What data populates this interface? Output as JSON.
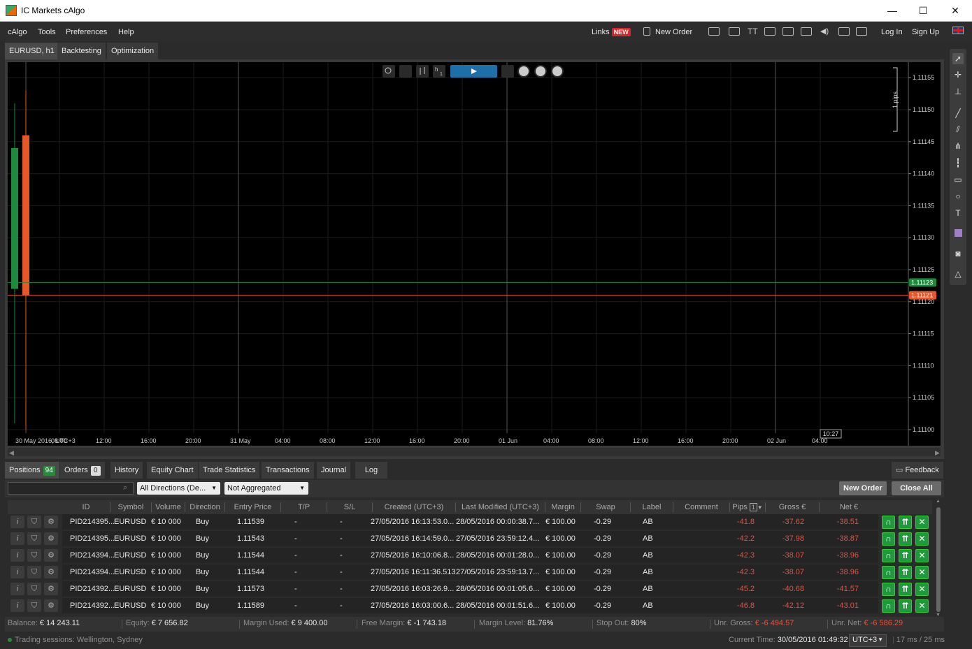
{
  "window": {
    "title": "IC Markets cAlgo",
    "minimize": "—",
    "maximize": "☐",
    "close": "✕"
  },
  "menu": {
    "items": [
      "cAlgo",
      "Tools",
      "Preferences",
      "Help"
    ],
    "links_label": "Links",
    "new_badge": "NEW",
    "new_order_label": "New Order",
    "login_label": "Log In",
    "signup_label": "Sign Up"
  },
  "chart_tabs": [
    "EURUSD, h1",
    "Backtesting",
    "Optimization"
  ],
  "chart": {
    "timeframe": "h",
    "timeframe_num": "1",
    "pips_label": "1 pips",
    "bid_price": "1.11123",
    "ask_price": "1.11121",
    "time_marker": "10:27",
    "bid_color": "#1e8a3e",
    "ask_color": "#e8572a"
  },
  "chart_data": {
    "type": "candlestick",
    "symbol": "EURUSD, h1",
    "y_ticks": [
      "1.11155",
      "1.11150",
      "1.11145",
      "1.11140",
      "1.11135",
      "1.11130",
      "1.11125",
      "1.11120",
      "1.11115",
      "1.11110",
      "1.11105",
      "1.11100"
    ],
    "ylim": [
      1.111,
      1.11157
    ],
    "x_ticks": [
      "30 May 2016, UTC+3",
      "08:00",
      "12:00",
      "16:00",
      "20:00",
      "31 May",
      "04:00",
      "08:00",
      "12:00",
      "16:00",
      "20:00",
      "01 Jun",
      "04:00",
      "08:00",
      "12:00",
      "16:00",
      "20:00",
      "02 Jun",
      "04:00"
    ],
    "candles": [
      {
        "open": 1.11122,
        "close": 1.11144,
        "high": 1.11151,
        "low": 1.11101,
        "color": "#1e8a3e"
      },
      {
        "open": 1.11146,
        "close": 1.11121,
        "high": 1.11153,
        "low": 1.111,
        "color": "#e8572a"
      }
    ]
  },
  "bottom_tabs": {
    "positions": "Positions",
    "positions_count": "94",
    "orders": "Orders",
    "orders_count": "0",
    "others": [
      "History",
      "Equity Chart",
      "Trade Statistics",
      "Transactions",
      "Journal",
      "Log"
    ],
    "feedback": "Feedback"
  },
  "filters": {
    "search_placeholder": "",
    "direction": "All Directions (De...",
    "aggregation": "Not Aggregated",
    "new_order": "New Order",
    "close_all": "Close All"
  },
  "columns": [
    "ID",
    "Symbol",
    "Volume",
    "Direction",
    "Entry Price",
    "T/P",
    "S/L",
    "Created (UTC+3)",
    "Last Modified (UTC+3)",
    "Margin",
    "Swap",
    "Label",
    "Comment",
    "Pips",
    "Gross €",
    "Net €"
  ],
  "pips_sort_badge": "1",
  "rows": [
    [
      "PID214395...",
      "EURUSD",
      "€ 10 000",
      "Buy",
      "1.11539",
      "-",
      "-",
      "27/05/2016 16:13:53.0...",
      "28/05/2016 00:00:38.7...",
      "€ 100.00",
      "-0.29",
      "AB",
      "",
      "-41.8",
      "-37.62",
      "-38.51"
    ],
    [
      "PID214395...",
      "EURUSD",
      "€ 10 000",
      "Buy",
      "1.11543",
      "-",
      "-",
      "27/05/2016 16:14:59.0...",
      "27/05/2016 23:59:12.4...",
      "€ 100.00",
      "-0.29",
      "AB",
      "",
      "-42.2",
      "-37.98",
      "-38.87"
    ],
    [
      "PID214394...",
      "EURUSD",
      "€ 10 000",
      "Buy",
      "1.11544",
      "-",
      "-",
      "27/05/2016 16:10:06.8...",
      "28/05/2016 00:01:28.0...",
      "€ 100.00",
      "-0.29",
      "AB",
      "",
      "-42.3",
      "-38.07",
      "-38.96"
    ],
    [
      "PID214394...",
      "EURUSD",
      "€ 10 000",
      "Buy",
      "1.11544",
      "-",
      "-",
      "27/05/2016 16:11:36.513",
      "27/05/2016 23:59:13.7...",
      "€ 100.00",
      "-0.29",
      "AB",
      "",
      "-42.3",
      "-38.07",
      "-38.96"
    ],
    [
      "PID214392...",
      "EURUSD",
      "€ 10 000",
      "Buy",
      "1.11573",
      "-",
      "-",
      "27/05/2016 16:03:26.9...",
      "28/05/2016 00:01:05.6...",
      "€ 100.00",
      "-0.29",
      "AB",
      "",
      "-45.2",
      "-40.68",
      "-41.57"
    ],
    [
      "PID214392...",
      "EURUSD",
      "€ 10 000",
      "Buy",
      "1.11589",
      "-",
      "-",
      "27/05/2016 16:03:00.6...",
      "28/05/2016 00:01:51.6...",
      "€ 100.00",
      "-0.29",
      "AB",
      "",
      "-46.8",
      "-42.12",
      "-43.01"
    ]
  ],
  "status": {
    "balance_label": "Balance:",
    "balance": "€ 14 243.11",
    "equity_label": "Equity:",
    "equity": "€ 7 656.82",
    "margin_used_label": "Margin Used:",
    "margin_used": "€ 9 400.00",
    "free_margin_label": "Free Margin:",
    "free_margin": "€ -1 743.18",
    "margin_level_label": "Margin Level:",
    "margin_level": "81.76%",
    "stop_out_label": "Stop Out:",
    "stop_out": "80%",
    "unr_gross_label": "Unr. Gross:",
    "unr_gross": "€ -6 494.57",
    "unr_net_label": "Unr. Net:",
    "unr_net": "€ -6 586.29"
  },
  "footer": {
    "sessions_label": "Trading sessions:",
    "sessions": "Wellington, Sydney",
    "time_label": "Current Time:",
    "time": "30/05/2016 01:49:32",
    "tz": "UTC+3",
    "latency": "17 ms / 25 ms"
  }
}
